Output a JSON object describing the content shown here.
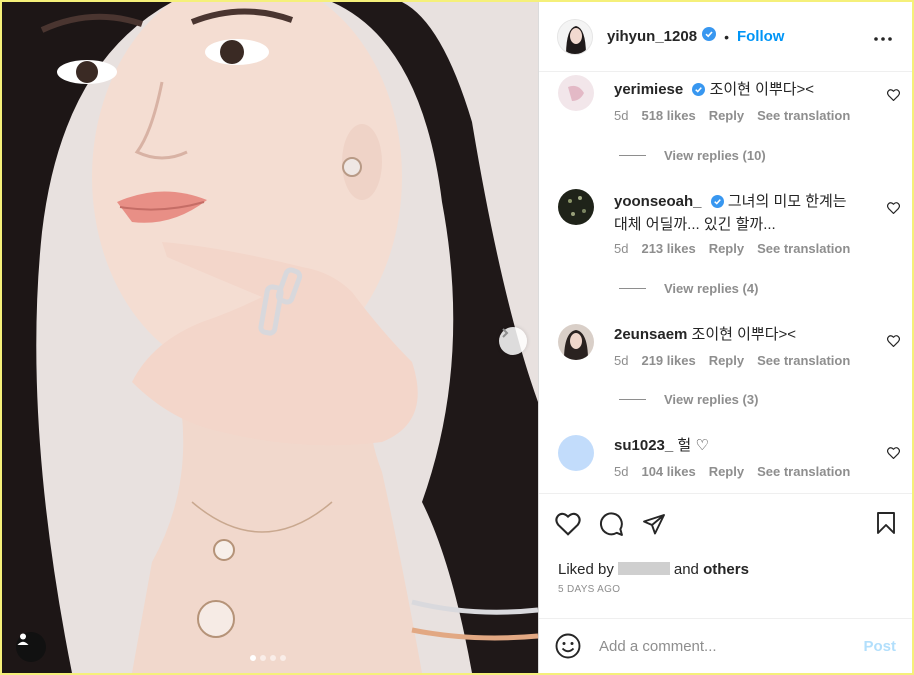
{
  "post": {
    "username": "yihyun_1208",
    "separator": "•",
    "follow_label": "Follow",
    "image_count": 4,
    "active_image": 1
  },
  "comments": [
    {
      "user": "yerimiese",
      "verified": true,
      "text": "조이현 이뿌다><",
      "age": "5d",
      "likes": "518 likes",
      "reply": "Reply",
      "translate": "See translation",
      "replies": "View replies (10)"
    },
    {
      "user": "yoonseoah_",
      "verified": true,
      "text": "그녀의 미모 한계는 대체 어딜까... 있긴 할까...",
      "age": "5d",
      "likes": "213 likes",
      "reply": "Reply",
      "translate": "See translation",
      "replies": "View replies (4)"
    },
    {
      "user": "2eunsaem",
      "verified": false,
      "text": "조이현 이뿌다><",
      "age": "5d",
      "likes": "219 likes",
      "reply": "Reply",
      "translate": "See translation",
      "replies": "View replies (3)"
    },
    {
      "user": "su1023_",
      "verified": false,
      "text": "헐 ♡",
      "age": "5d",
      "likes": "104 likes",
      "reply": "Reply",
      "translate": "See translation"
    }
  ],
  "likes": {
    "prefix": "Liked by",
    "middle": "and",
    "others": "others"
  },
  "date": "5 DAYS AGO",
  "composer": {
    "placeholder": "Add a comment...",
    "post_label": "Post"
  },
  "colors": {
    "accent": "#0095f6",
    "post_disabled": "#b2dffc",
    "frame": "#f5f07a"
  },
  "icons": [
    "verified-badge-icon",
    "more-options-icon",
    "heart-icon",
    "comment-icon",
    "share-icon",
    "bookmark-icon",
    "emoji-icon",
    "next-arrow-icon",
    "user-tag-icon"
  ]
}
